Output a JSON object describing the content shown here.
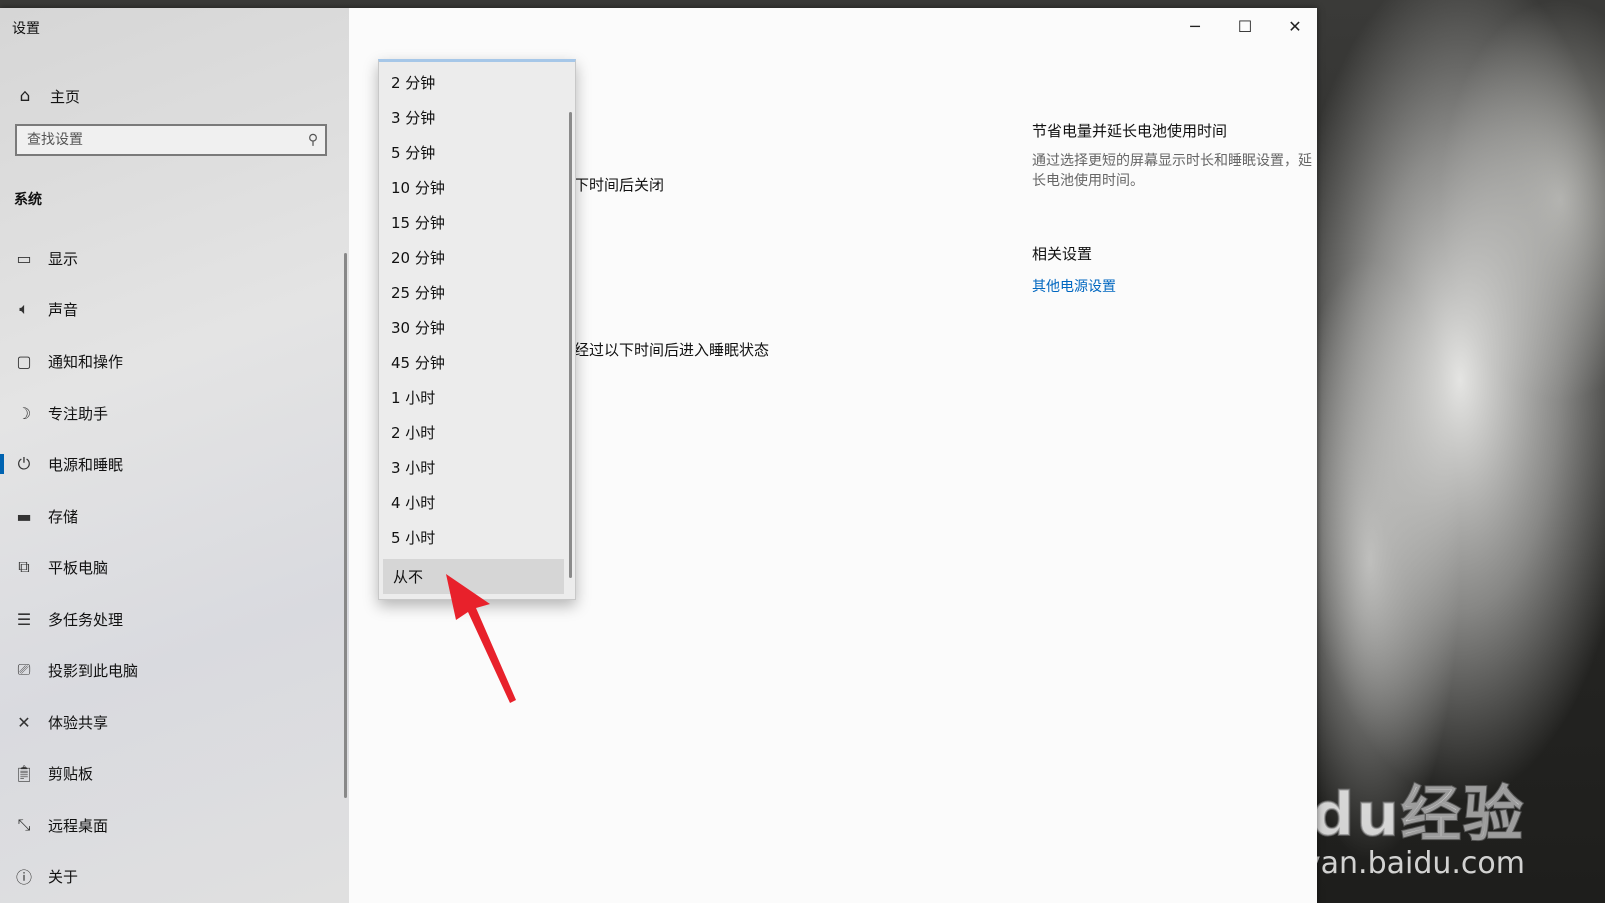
{
  "window": {
    "title": "设置",
    "controls": {
      "minimize": "minimize",
      "maximize": "maximize",
      "close": "close"
    }
  },
  "sidebar": {
    "home": {
      "label": "主页",
      "icon": "home-icon"
    },
    "search": {
      "placeholder": "查找设置",
      "icon": "search-icon"
    },
    "section": "系统",
    "items": [
      {
        "label": "显示",
        "icon": "display-icon"
      },
      {
        "label": "声音",
        "icon": "sound-icon"
      },
      {
        "label": "通知和操作",
        "icon": "notification-icon"
      },
      {
        "label": "专注助手",
        "icon": "moon-icon"
      },
      {
        "label": "电源和睡眠",
        "icon": "power-icon",
        "active": true
      },
      {
        "label": "存储",
        "icon": "storage-icon"
      },
      {
        "label": "平板电脑",
        "icon": "tablet-icon"
      },
      {
        "label": "多任务处理",
        "icon": "multitask-icon"
      },
      {
        "label": "投影到此电脑",
        "icon": "project-icon"
      },
      {
        "label": "体验共享",
        "icon": "share-icon"
      },
      {
        "label": "剪贴板",
        "icon": "clipboard-icon"
      },
      {
        "label": "远程桌面",
        "icon": "remote-desktop-icon"
      },
      {
        "label": "关于",
        "icon": "info-icon"
      }
    ]
  },
  "main": {
    "screen_off_text": "下时间后关闭",
    "sleep_text": "经过以下时间后进入睡眠状态"
  },
  "side_panel": {
    "heading": "节省电量并延长电池使用时间",
    "description": "通过选择更短的屏幕显示时长和睡眠设置，延长电池使用时间。",
    "related_heading": "相关设置",
    "related_link": "其他电源设置"
  },
  "dropdown": {
    "options": [
      "2 分钟",
      "3 分钟",
      "5 分钟",
      "10 分钟",
      "15 分钟",
      "20 分钟",
      "25 分钟",
      "30 分钟",
      "45 分钟",
      "1 小时",
      "2 小时",
      "3 小时",
      "4 小时",
      "5 小时",
      "从不"
    ],
    "highlighted": "从不"
  },
  "annotation": {
    "color": "#e8212b"
  },
  "watermark": {
    "brand": "Baidu经验",
    "url": "jingyan.baidu.com"
  }
}
